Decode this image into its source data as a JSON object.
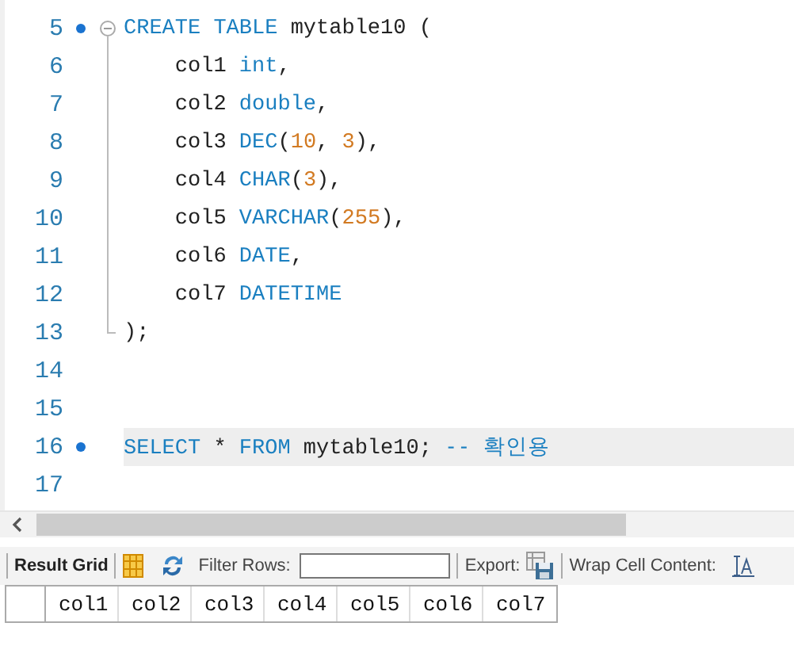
{
  "editor": {
    "lines": [
      {
        "number": "5",
        "marker": true,
        "kind": "fold_start",
        "highlighted": false,
        "tokens": [
          {
            "text": "CREATE TABLE",
            "kind": "keyword"
          },
          {
            "text": " mytable10 (",
            "kind": "plain"
          }
        ]
      },
      {
        "number": "6",
        "marker": false,
        "kind": "fold_body",
        "highlighted": false,
        "tokens": [
          {
            "text": "    col1 ",
            "kind": "plain"
          },
          {
            "text": "int",
            "kind": "keyword"
          },
          {
            "text": ",",
            "kind": "plain"
          }
        ]
      },
      {
        "number": "7",
        "marker": false,
        "kind": "fold_body",
        "highlighted": false,
        "tokens": [
          {
            "text": "    col2 ",
            "kind": "plain"
          },
          {
            "text": "double",
            "kind": "keyword"
          },
          {
            "text": ",",
            "kind": "plain"
          }
        ]
      },
      {
        "number": "8",
        "marker": false,
        "kind": "fold_body",
        "highlighted": false,
        "tokens": [
          {
            "text": "    col3 ",
            "kind": "plain"
          },
          {
            "text": "DEC",
            "kind": "keyword"
          },
          {
            "text": "(",
            "kind": "plain"
          },
          {
            "text": "10",
            "kind": "number"
          },
          {
            "text": ", ",
            "kind": "plain"
          },
          {
            "text": "3",
            "kind": "number"
          },
          {
            "text": "),",
            "kind": "plain"
          }
        ]
      },
      {
        "number": "9",
        "marker": false,
        "kind": "fold_body",
        "highlighted": false,
        "tokens": [
          {
            "text": "    col4 ",
            "kind": "plain"
          },
          {
            "text": "CHAR",
            "kind": "keyword"
          },
          {
            "text": "(",
            "kind": "plain"
          },
          {
            "text": "3",
            "kind": "number"
          },
          {
            "text": "),",
            "kind": "plain"
          }
        ]
      },
      {
        "number": "10",
        "marker": false,
        "kind": "fold_body",
        "highlighted": false,
        "tokens": [
          {
            "text": "    col5 ",
            "kind": "plain"
          },
          {
            "text": "VARCHAR",
            "kind": "keyword"
          },
          {
            "text": "(",
            "kind": "plain"
          },
          {
            "text": "255",
            "kind": "number"
          },
          {
            "text": "),",
            "kind": "plain"
          }
        ]
      },
      {
        "number": "11",
        "marker": false,
        "kind": "fold_body",
        "highlighted": false,
        "tokens": [
          {
            "text": "    col6 ",
            "kind": "plain"
          },
          {
            "text": "DATE",
            "kind": "keyword"
          },
          {
            "text": ",",
            "kind": "plain"
          }
        ]
      },
      {
        "number": "12",
        "marker": false,
        "kind": "fold_body",
        "highlighted": false,
        "tokens": [
          {
            "text": "    col7 ",
            "kind": "plain"
          },
          {
            "text": "DATETIME",
            "kind": "keyword"
          }
        ]
      },
      {
        "number": "13",
        "marker": false,
        "kind": "fold_end",
        "highlighted": false,
        "tokens": [
          {
            "text": ");",
            "kind": "plain"
          }
        ]
      },
      {
        "number": "14",
        "marker": false,
        "kind": "plain",
        "highlighted": false
      },
      {
        "number": "15",
        "marker": false,
        "kind": "plain",
        "highlighted": false
      },
      {
        "number": "16",
        "marker": true,
        "kind": "plain",
        "highlighted": true,
        "tokens": [
          {
            "text": "SELECT",
            "kind": "keyword"
          },
          {
            "text": " * ",
            "kind": "plain"
          },
          {
            "text": "FROM",
            "kind": "keyword"
          },
          {
            "text": " mytable10; ",
            "kind": "plain"
          },
          {
            "text": "-- 확인용",
            "kind": "comment"
          }
        ]
      },
      {
        "number": "17",
        "marker": false,
        "kind": "plain",
        "highlighted": false
      }
    ]
  },
  "toolbar": {
    "result_grid": "Result Grid",
    "filter_label": "Filter Rows:",
    "export_label": "Export:",
    "wrap_label": "Wrap Cell Content:"
  },
  "grid": {
    "columns": [
      "col1",
      "col2",
      "col3",
      "col4",
      "col5",
      "col6",
      "col7"
    ]
  }
}
